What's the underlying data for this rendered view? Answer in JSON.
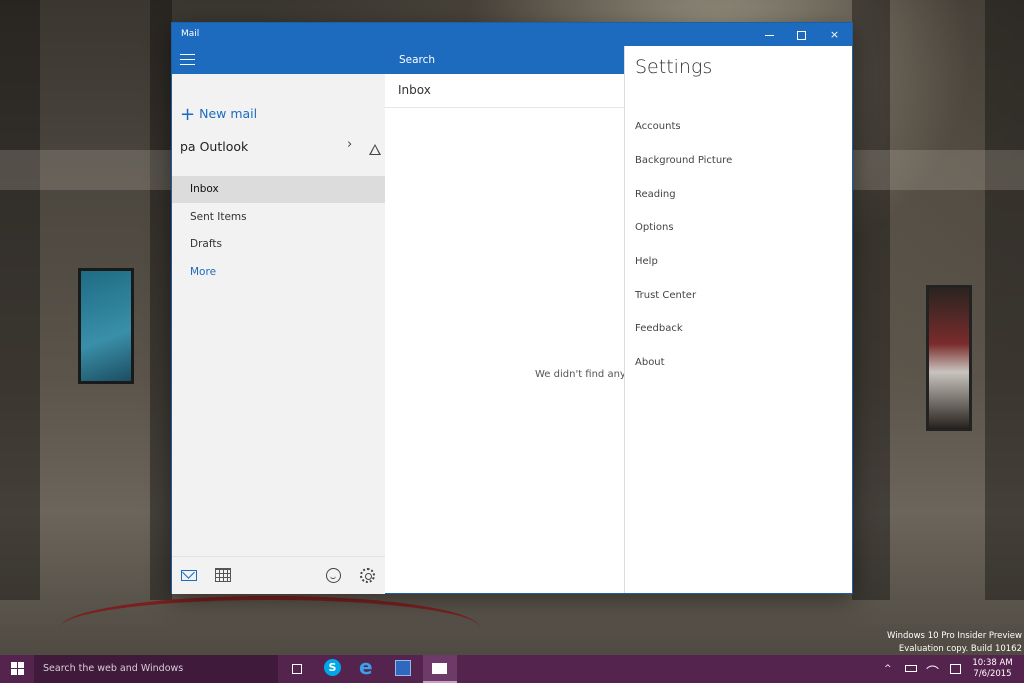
{
  "window": {
    "title": "Mail",
    "min_label": "",
    "max_label": "",
    "close_label": "×"
  },
  "left_pane": {
    "new_mail_label": "New mail",
    "account_name": "pa Outlook",
    "folders": [
      {
        "label": "Inbox",
        "active": true
      },
      {
        "label": "Sent Items",
        "active": false
      },
      {
        "label": "Drafts",
        "active": false
      },
      {
        "label": "More",
        "active": false
      }
    ]
  },
  "middle_pane": {
    "search_placeholder": "Search",
    "folder_header": "Inbox",
    "empty_message": "We didn't find anyth"
  },
  "settings": {
    "title": "Settings",
    "items": [
      "Accounts",
      "Background Picture",
      "Reading",
      "Options",
      "Help",
      "Trust Center",
      "Feedback",
      "About"
    ]
  },
  "watermark": {
    "line1": "Windows 10 Pro Insider Preview",
    "line2": "Evaluation copy. Build 10162"
  },
  "taskbar": {
    "search_placeholder": "Search the web and Windows",
    "time": "10:38 AM",
    "date": "7/6/2015",
    "tray_chevron": "^",
    "pinned": [
      "task-view",
      "skype",
      "internet-explorer",
      "outlook",
      "mail"
    ]
  },
  "colors": {
    "accent": "#1c6bbf",
    "taskbar": "#54244f",
    "left_pane_bg": "#f2f2f2"
  }
}
